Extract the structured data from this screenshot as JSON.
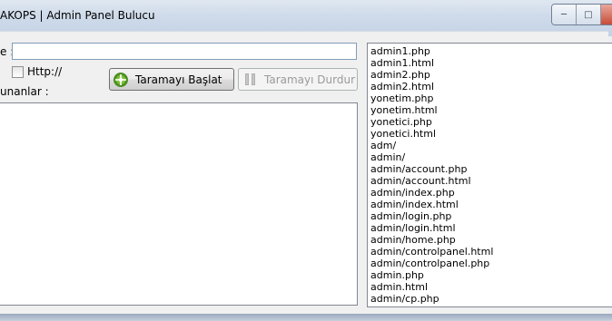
{
  "window": {
    "title": "AKOPS | Admin Panel Bulucu",
    "controls": {
      "minimize_icon": "minimize-icon",
      "maximize_icon": "maximize-icon",
      "close_icon": "close-icon"
    }
  },
  "form": {
    "site_label": "e :",
    "site_value": "",
    "http_label": "Http://",
    "http_checked": false,
    "results_label": "unanlar :",
    "start_button": "Taramayı Başlat",
    "stop_button": "Taramayı Durdur"
  },
  "paths": [
    "admin1.php",
    "admin1.html",
    "admin2.php",
    "admin2.html",
    "yonetim.php",
    "yonetim.html",
    "yonetici.php",
    "yonetici.html",
    "adm/",
    "admin/",
    "admin/account.php",
    "admin/account.html",
    "admin/index.php",
    "admin/index.html",
    "admin/login.php",
    "admin/login.html",
    "admin/home.php",
    "admin/controlpanel.html",
    "admin/controlpanel.php",
    "admin.php",
    "admin.html",
    "admin/cp.php"
  ]
}
